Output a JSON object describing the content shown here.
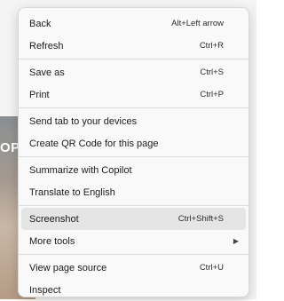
{
  "background": {
    "partial_text": "OP"
  },
  "context_menu": {
    "groups": [
      {
        "items": [
          {
            "label": "Back",
            "shortcut": "Alt+Left arrow"
          },
          {
            "label": "Refresh",
            "shortcut": "Ctrl+R"
          }
        ]
      },
      {
        "items": [
          {
            "label": "Save as",
            "shortcut": "Ctrl+S"
          },
          {
            "label": "Print",
            "shortcut": "Ctrl+P"
          }
        ]
      },
      {
        "items": [
          {
            "label": "Send tab to your devices",
            "shortcut": ""
          },
          {
            "label": "Create QR Code for this page",
            "shortcut": ""
          }
        ]
      },
      {
        "items": [
          {
            "label": "Summarize with Copilot",
            "shortcut": ""
          },
          {
            "label": "Translate to English",
            "shortcut": ""
          }
        ]
      },
      {
        "items": [
          {
            "label": "Screenshot",
            "shortcut": "Ctrl+Shift+S",
            "highlighted": true
          },
          {
            "label": "More tools",
            "shortcut": "",
            "submenu_icon": "chevron-right-icon"
          }
        ]
      },
      {
        "items": [
          {
            "label": "View page source",
            "shortcut": "Ctrl+U"
          },
          {
            "label": "Inspect",
            "shortcut": ""
          }
        ]
      }
    ],
    "highlight_color": "#e5e5e5"
  }
}
